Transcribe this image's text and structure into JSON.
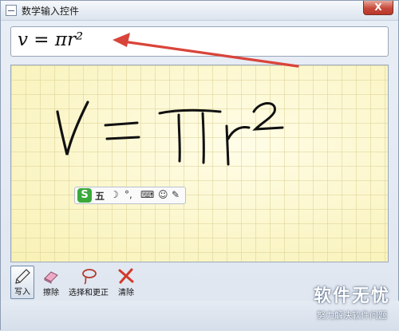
{
  "window": {
    "title": "数学输入控件",
    "close_label": "X"
  },
  "preview": {
    "formula": "v = πr²"
  },
  "handwriting": {
    "text": "V=πr²"
  },
  "ime": {
    "logo": "S",
    "mode": "五",
    "items": [
      "☽",
      "°,",
      "⌨",
      "☺",
      "✎"
    ]
  },
  "toolbar": {
    "write": "写入",
    "erase": "擦除",
    "select_correct": "选择和更正",
    "clear": "清除"
  },
  "watermark": {
    "main": "软件无忧",
    "sub": "努力解决软件问题"
  },
  "colors": {
    "arrow": "#d9443a",
    "canvas": "#fcf9d2",
    "ink": "#111111",
    "ime_logo": "#3aa93a"
  }
}
